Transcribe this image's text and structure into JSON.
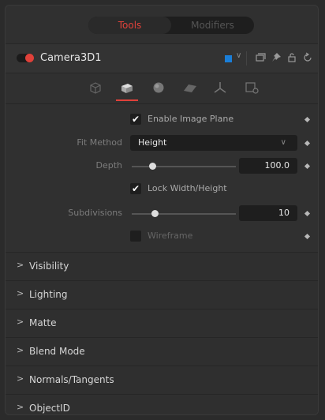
{
  "tabs": [
    {
      "label": "Tools",
      "active": true
    },
    {
      "label": "Modifiers",
      "active": false
    }
  ],
  "header": {
    "title": "Camera3D1",
    "color_swatch": "#1a7ed8",
    "icons": [
      "square-icon",
      "chevron-down-icon",
      "copy-icon",
      "pin-icon",
      "lock-icon",
      "reset-icon"
    ]
  },
  "iconbar": {
    "icons": [
      "controls-tab-icon",
      "image-plane-tab-icon",
      "sphere-tab-icon",
      "surface-tab-icon",
      "transform-tab-icon",
      "settings-tab-icon"
    ],
    "active_index": 1
  },
  "controls": {
    "enable_image_plane": {
      "label": "Enable Image Plane",
      "checked": true,
      "checkmark": "✔"
    },
    "fit_method": {
      "label": "Fit Method",
      "value": "Height"
    },
    "depth": {
      "label": "Depth",
      "value": "100.0",
      "slider_fraction": 0.2
    },
    "lock_width_height": {
      "label": "Lock Width/Height",
      "checked": true,
      "checkmark": "✔"
    },
    "subdivisions": {
      "label": "Subdivisions",
      "value": "10",
      "slider_fraction": 0.22
    },
    "wireframe": {
      "label": "Wireframe",
      "checked": false
    }
  },
  "sections": [
    {
      "label": "Visibility"
    },
    {
      "label": "Lighting"
    },
    {
      "label": "Matte"
    },
    {
      "label": "Blend Mode"
    },
    {
      "label": "Normals/Tangents"
    },
    {
      "label": "ObjectID"
    }
  ],
  "colors": {
    "accent": "#e0413a",
    "background": "#303030"
  }
}
